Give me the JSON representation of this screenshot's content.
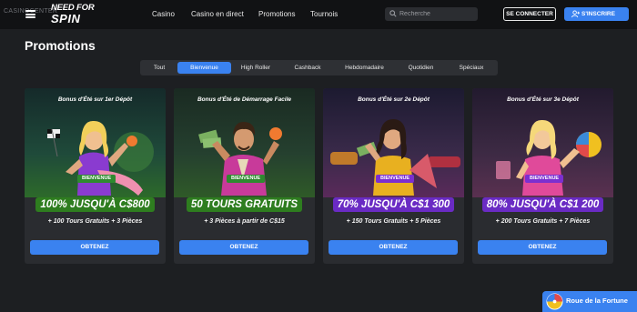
{
  "watermark": "CASINOCENTER",
  "logo": {
    "line1": "NEED FOR",
    "line2": "SPIN"
  },
  "nav": [
    "Casino",
    "Casino en direct",
    "Promotions",
    "Tournois"
  ],
  "search": {
    "placeholder": "Recherche"
  },
  "auth": {
    "login": "SE CONNECTER",
    "signup": "S'INSCRIRE"
  },
  "page_title": "Promotions",
  "tabs": [
    {
      "label": "Tout",
      "active": false
    },
    {
      "label": "Bienvenue",
      "active": true
    },
    {
      "label": "High Roller",
      "active": false
    },
    {
      "label": "Cashback",
      "active": false
    },
    {
      "label": "Hebdomadaire",
      "active": false
    },
    {
      "label": "Quotidien",
      "active": false
    },
    {
      "label": "Spéciaux",
      "active": false
    }
  ],
  "cards": [
    {
      "badge": "BIENVENUE",
      "badge_color": "#2f8a2f",
      "title": "Bonus d'Été sur 1er Dépôt",
      "headline": "100% JUSQU'À C$800",
      "headline_color": "#2e7d1f",
      "sub": "+ 100 Tours Gratuits + 3 Pièces",
      "cta": "OBTENEZ"
    },
    {
      "badge": "BIENVENUE",
      "badge_color": "#2f8a2f",
      "title": "Bonus d'Été de Démarrage Facile",
      "headline": "50 TOURS GRATUITS",
      "headline_color": "#2e7d1f",
      "sub": "+ 3 Pièces à partir de C$15",
      "cta": "OBTENEZ"
    },
    {
      "badge": "BIENVENUE",
      "badge_color": "#7b2fd0",
      "title": "Bonus d'Été sur 2e Dépôt",
      "headline": "70% JUSQU'À C$1 300",
      "headline_color": "#6a2bc4",
      "sub": "+ 150 Tours Gratuits + 5 Pièces",
      "cta": "OBTENEZ"
    },
    {
      "badge": "BIENVENUE",
      "badge_color": "#7b2fd0",
      "title": "Bonus d'Été sur 3e Dépôt",
      "headline": "80% JUSQU'À C$1 200",
      "headline_color": "#6a2bc4",
      "sub": "+ 200 Tours Gratuits + 7 Pièces",
      "cta": "OBTENEZ"
    }
  ],
  "wheel": {
    "label": "Roue de la Fortune"
  },
  "colors": {
    "accent": "#3a82f0",
    "header_bg": "#111214",
    "page_bg": "#1d1f22",
    "card_bg": "#2a2c30"
  }
}
